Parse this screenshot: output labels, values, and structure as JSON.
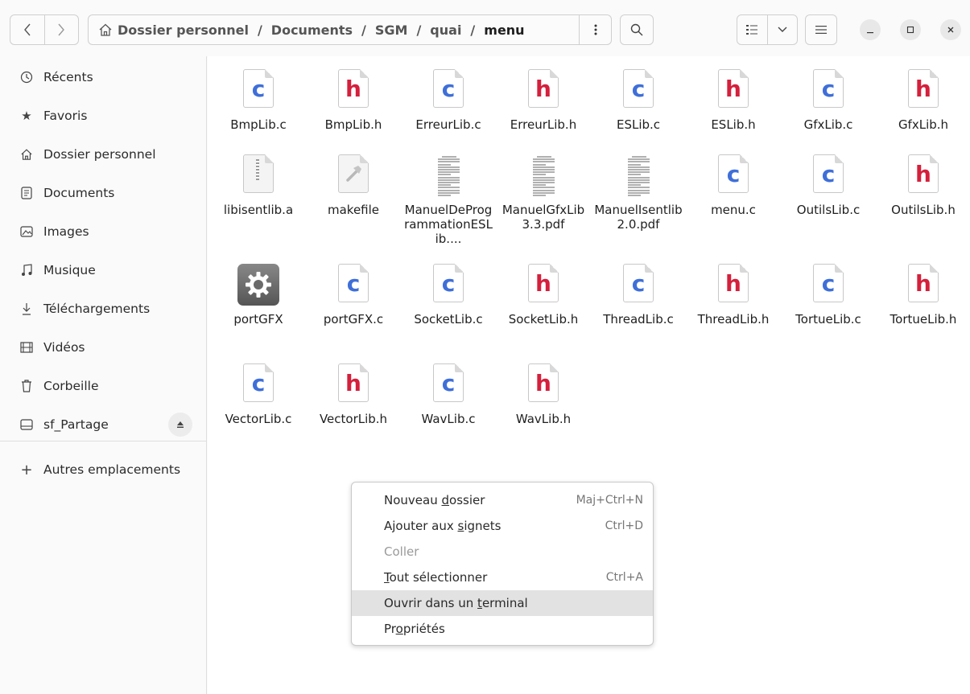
{
  "header": {
    "back_icon": "chevron-left-icon",
    "forward_icon": "chevron-right-icon",
    "path": {
      "home_icon": "home-icon",
      "crumbs": [
        "Dossier personnel",
        "Documents",
        "SGM",
        "quai",
        "menu"
      ],
      "more_icon": "vertical-dots-icon"
    },
    "search_icon": "search-icon",
    "view_list_icon": "list-view-icon",
    "view_dropdown_icon": "chevron-down-icon",
    "menu_icon": "hamburger-icon",
    "window": {
      "minimize": "minimize-icon",
      "maximize": "maximize-icon",
      "close": "close-icon"
    }
  },
  "sidebar": {
    "items": [
      {
        "label": "Récents",
        "icon": "clock-icon"
      },
      {
        "label": "Favoris",
        "icon": "star-icon"
      },
      {
        "label": "Dossier personnel",
        "icon": "home-icon"
      },
      {
        "label": "Documents",
        "icon": "document-icon"
      },
      {
        "label": "Images",
        "icon": "image-icon"
      },
      {
        "label": "Musique",
        "icon": "music-icon"
      },
      {
        "label": "Téléchargements",
        "icon": "download-icon"
      },
      {
        "label": "Vidéos",
        "icon": "video-icon"
      },
      {
        "label": "Corbeille",
        "icon": "trash-icon"
      },
      {
        "label": "sf_Partage",
        "icon": "drive-icon"
      }
    ],
    "eject_icon": "eject-icon",
    "other_locations": "Autres emplacements",
    "other_locations_icon": "plus-icon"
  },
  "files": [
    {
      "name": "BmpLib.c",
      "type": "c"
    },
    {
      "name": "BmpLib.h",
      "type": "h"
    },
    {
      "name": "ErreurLib.c",
      "type": "c"
    },
    {
      "name": "ErreurLib.h",
      "type": "h"
    },
    {
      "name": "ESLib.c",
      "type": "c"
    },
    {
      "name": "ESLib.h",
      "type": "h"
    },
    {
      "name": "GfxLib.c",
      "type": "c"
    },
    {
      "name": "GfxLib.h",
      "type": "h"
    },
    {
      "name": "libisentlib.a",
      "type": "archive"
    },
    {
      "name": "makefile",
      "type": "makefile"
    },
    {
      "name": "ManuelDeProgrammationESLib....",
      "type": "pdf"
    },
    {
      "name": "ManuelGfxLib3.3.pdf",
      "type": "pdf"
    },
    {
      "name": "ManuelIsentlib2.0.pdf",
      "type": "pdf"
    },
    {
      "name": "menu.c",
      "type": "c"
    },
    {
      "name": "OutilsLib.c",
      "type": "c"
    },
    {
      "name": "OutilsLib.h",
      "type": "h"
    },
    {
      "name": "portGFX",
      "type": "exec"
    },
    {
      "name": "portGFX.c",
      "type": "c"
    },
    {
      "name": "SocketLib.c",
      "type": "c"
    },
    {
      "name": "SocketLib.h",
      "type": "h"
    },
    {
      "name": "ThreadLib.c",
      "type": "c"
    },
    {
      "name": "ThreadLib.h",
      "type": "h"
    },
    {
      "name": "TortueLib.c",
      "type": "c"
    },
    {
      "name": "TortueLib.h",
      "type": "h"
    },
    {
      "name": "VectorLib.c",
      "type": "c"
    },
    {
      "name": "VectorLib.h",
      "type": "h"
    },
    {
      "name": "WavLib.c",
      "type": "c"
    },
    {
      "name": "WavLib.h",
      "type": "h"
    }
  ],
  "icon_letters": {
    "c": "c",
    "h": "h"
  },
  "context_menu": {
    "items": [
      {
        "label_pre": "Nouveau ",
        "mnemonic": "d",
        "label_post": "ossier",
        "shortcut": "Maj+Ctrl+N",
        "disabled": false,
        "highlighted": false
      },
      {
        "label_pre": "Ajouter aux ",
        "mnemonic": "s",
        "label_post": "ignets",
        "shortcut": "Ctrl+D",
        "disabled": false,
        "highlighted": false
      },
      {
        "label_pre": "Coller",
        "mnemonic": "",
        "label_post": "",
        "shortcut": "",
        "disabled": true,
        "highlighted": false
      },
      {
        "label_pre": "",
        "mnemonic": "T",
        "label_post": "out sélectionner",
        "shortcut": "Ctrl+A",
        "disabled": false,
        "highlighted": false
      },
      {
        "label_pre": "Ouvrir dans un ",
        "mnemonic": "t",
        "label_post": "erminal",
        "shortcut": "",
        "disabled": false,
        "highlighted": true
      },
      {
        "label_pre": "Pr",
        "mnemonic": "o",
        "label_post": "priétés",
        "shortcut": "",
        "disabled": false,
        "highlighted": false
      }
    ]
  },
  "colors": {
    "c_letter": "#3f6fd8",
    "h_letter": "#d4203c",
    "menu_highlight": "#e2e2e2"
  }
}
